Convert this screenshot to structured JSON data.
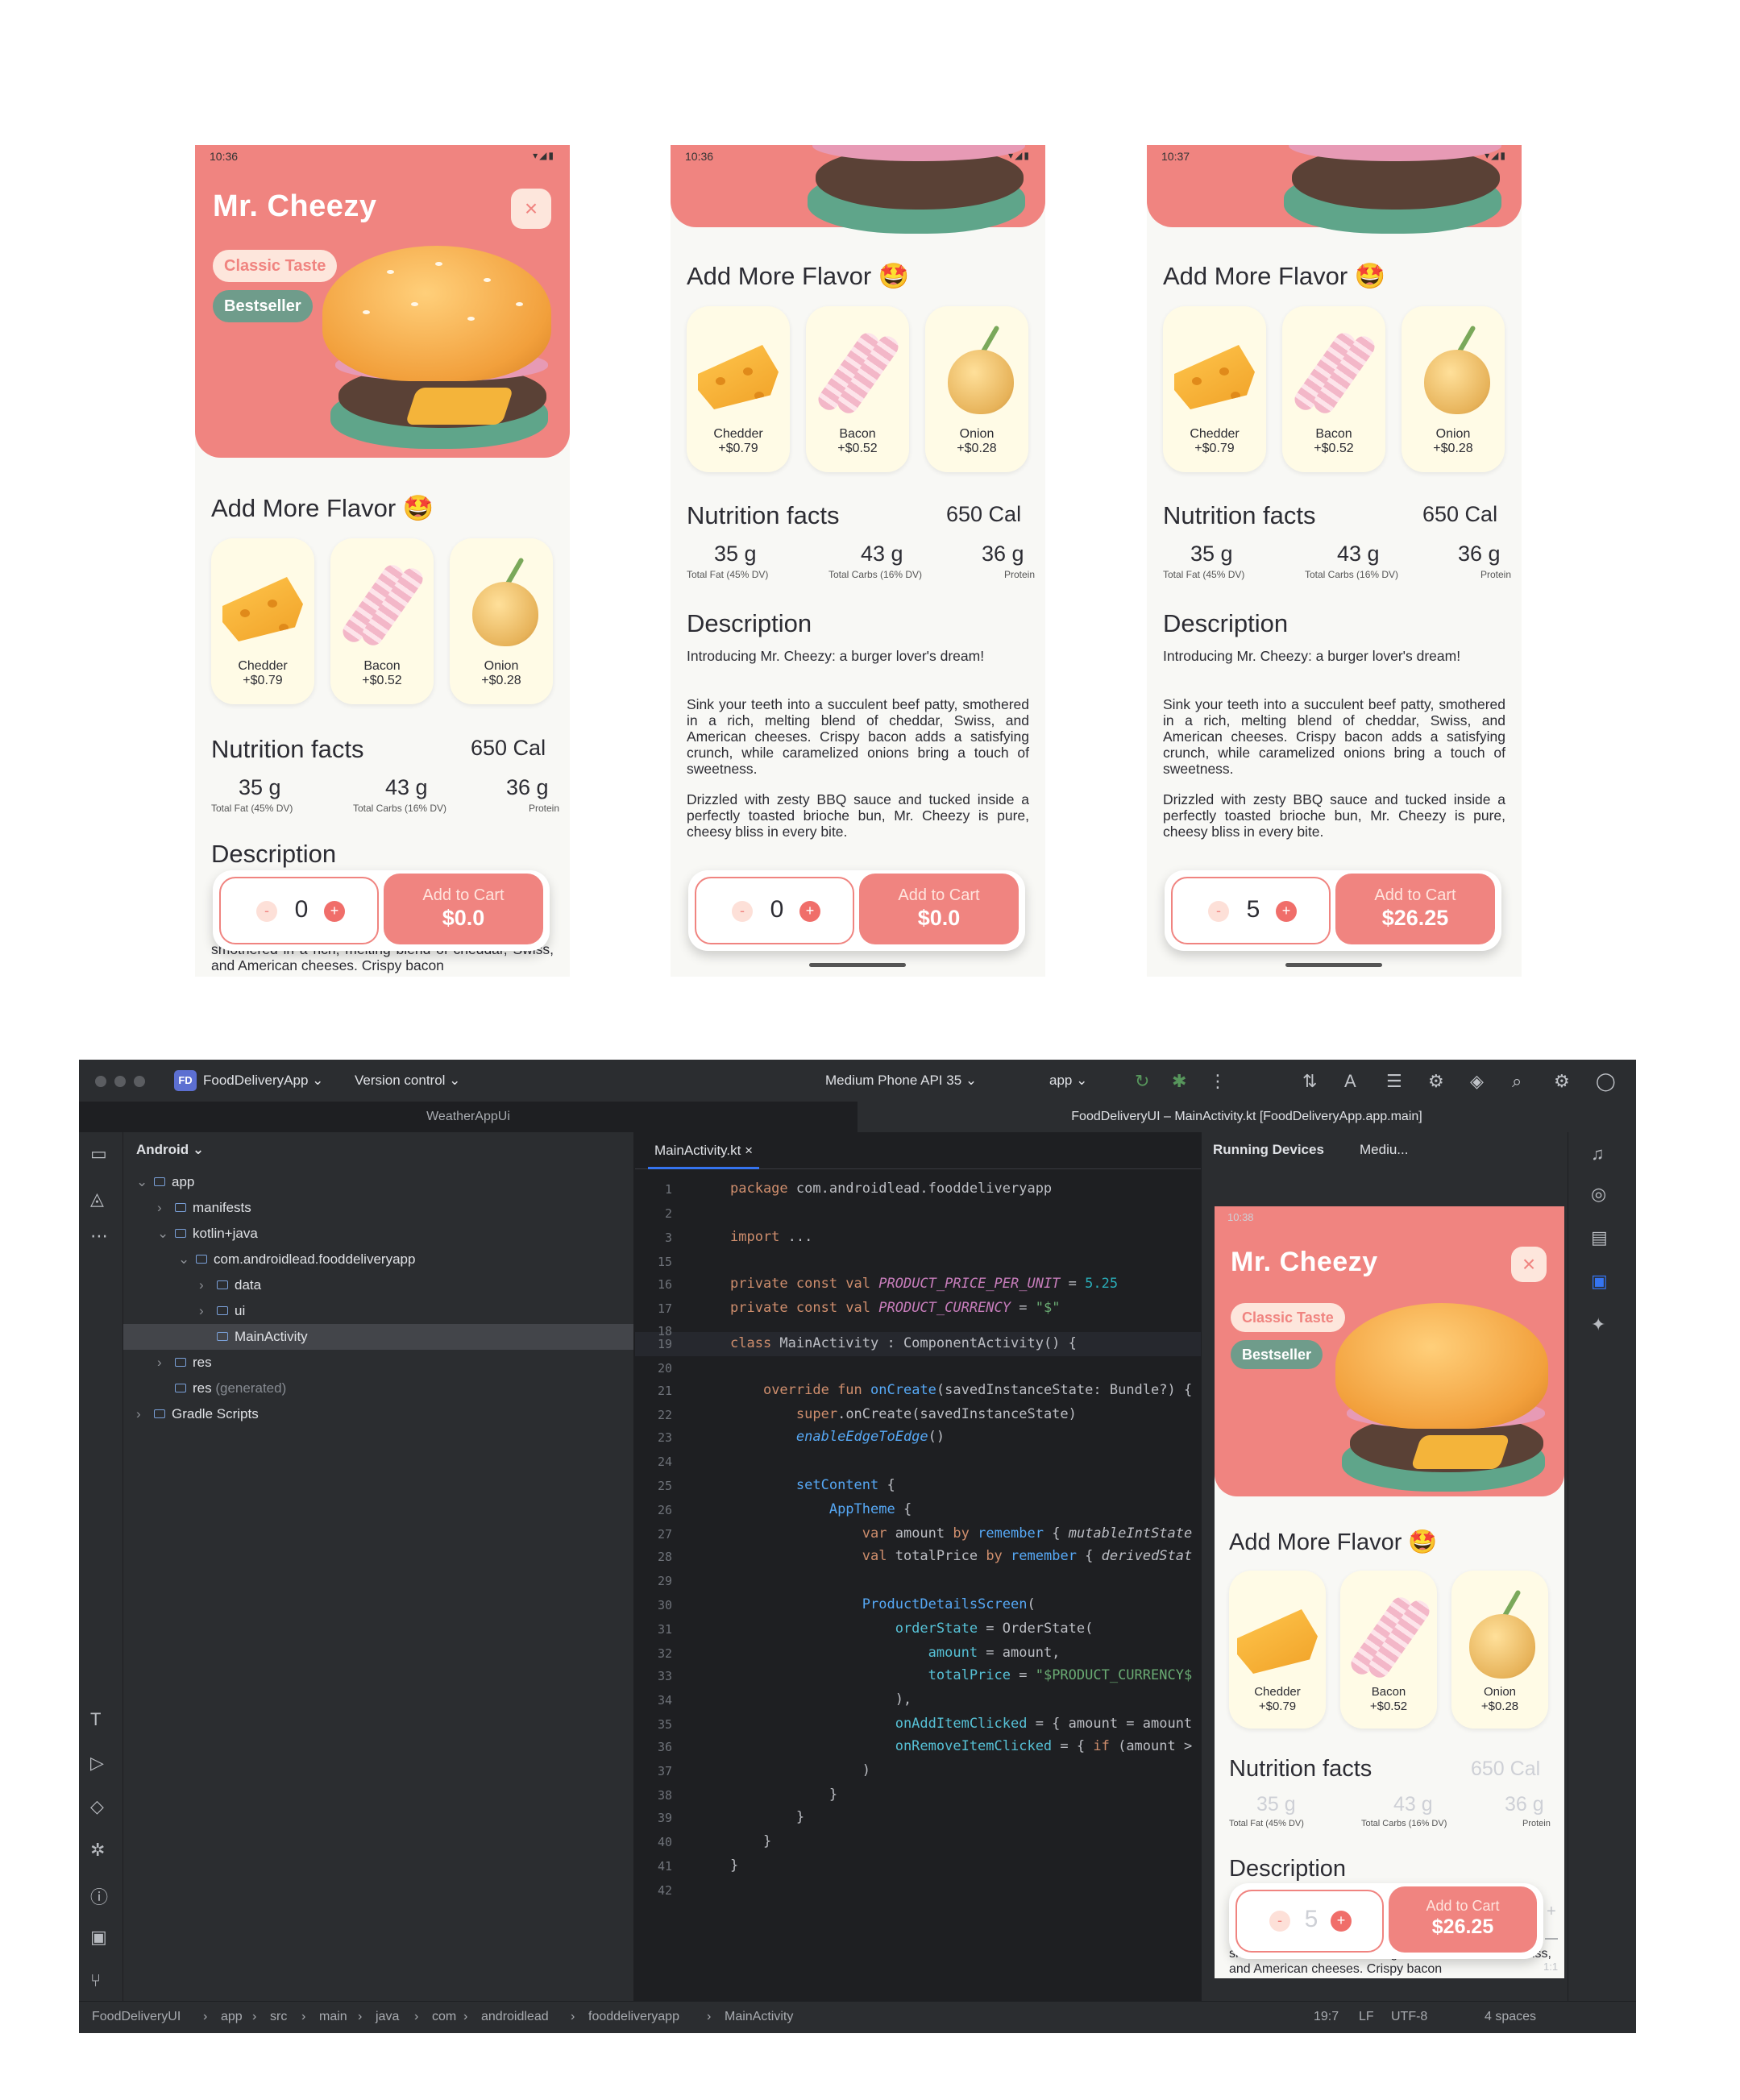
{
  "product": {
    "name": "Mr. Cheezy",
    "tag_classic": "Classic Taste",
    "tag_best": "Bestseller",
    "close_glyph": "×",
    "add_more_title": "Add More Flavor 🤩",
    "toppings": [
      {
        "name": "Chedder",
        "price": "+$0.79"
      },
      {
        "name": "Bacon",
        "price": "+$0.52"
      },
      {
        "name": "Onion",
        "price": "+$0.28"
      }
    ],
    "nutrition_title": "Nutrition facts",
    "calories": "650 Cal",
    "nutrients": [
      {
        "value": "35 g",
        "label": "Total Fat (45% DV)"
      },
      {
        "value": "43 g",
        "label": "Total Carbs (16% DV)"
      },
      {
        "value": "36 g",
        "label": "Protein"
      }
    ],
    "description_title": "Description",
    "description_p1": "Introducing Mr. Cheezy: a burger lover's dream!",
    "description_p2": "Sink your teeth into a succulent beef patty, smothered in a rich, melting blend of cheddar, Swiss, and American cheeses. Crispy bacon adds a satisfying crunch, while caramelized onions bring a touch of sweetness.",
    "description_p3": "Drizzled with zesty BBQ sauce and tucked inside a perfectly toasted brioche bun, Mr. Cheezy is pure, cheesy bliss in every bite.",
    "peek_text": "smothered in a rich, melting blend of cheddar, Swiss, and American cheeses. Crispy bacon",
    "add_to_cart": "Add to Cart",
    "minus": "-",
    "plus": "+"
  },
  "screens": [
    {
      "time": "10:36",
      "qty": "0",
      "total": "$0.0"
    },
    {
      "time": "10:36",
      "qty": "0",
      "total": "$0.0"
    },
    {
      "time": "10:37",
      "qty": "5",
      "total": "$26.25"
    }
  ],
  "status_icons": "▾◢▮",
  "ide": {
    "project_badge": "FD",
    "project_name": "FoodDeliveryApp ⌄",
    "version_control": "Version control ⌄",
    "device_selector": "Medium Phone API 35 ⌄",
    "run_config": "app ⌄",
    "window_tabs": [
      "WeatherAppUi",
      "FoodDeliveryUI – MainActivity.kt [FoodDeliveryApp.app.main]"
    ],
    "panel_title": "Android ⌄",
    "tree": [
      {
        "label": "app",
        "depth": 0,
        "arrow": "⌄"
      },
      {
        "label": "manifests",
        "depth": 1,
        "arrow": "›"
      },
      {
        "label": "kotlin+java",
        "depth": 1,
        "arrow": "⌄"
      },
      {
        "label": "com.androidlead.fooddeliveryapp",
        "depth": 2,
        "arrow": "⌄"
      },
      {
        "label": "data",
        "depth": 3,
        "arrow": "›"
      },
      {
        "label": "ui",
        "depth": 3,
        "arrow": "›"
      },
      {
        "label": "MainActivity",
        "depth": 3,
        "arrow": ""
      },
      {
        "label": "res",
        "depth": 1,
        "arrow": "›"
      },
      {
        "label": "res",
        "depth": 1,
        "arrow": "",
        "suffix": " (generated)"
      },
      {
        "label": "Gradle Scripts",
        "depth": 0,
        "arrow": "›"
      }
    ],
    "editor_tab": "MainActivity.kt ×",
    "line_numbers": [
      "1",
      "2",
      "3",
      "15",
      "16",
      "17",
      "18",
      "19",
      "20",
      "21",
      "22",
      "23",
      "24",
      "25",
      "26",
      "27",
      "28",
      "29",
      "30",
      "31",
      "32",
      "33",
      "34",
      "35",
      "36",
      "37",
      "38",
      "39",
      "40",
      "41",
      "42"
    ],
    "running_devices": "Running Devices",
    "device_tab": "Mediu...",
    "mini_time": "10:38",
    "mini_qty": "5",
    "mini_total": "$26.25",
    "zoom_plus": "+",
    "zoom_minus": "—",
    "zoom_ratio": "1:1",
    "breadcrumbs": [
      "FoodDeliveryUI",
      "app",
      "src",
      "main",
      "java",
      "com",
      "androidlead",
      "fooddeliveryapp",
      "MainActivity"
    ],
    "crumb_sep": "›",
    "status_position": "19:7",
    "status_lf": "LF",
    "status_encoding": "UTF-8",
    "status_indent": "4 spaces"
  }
}
